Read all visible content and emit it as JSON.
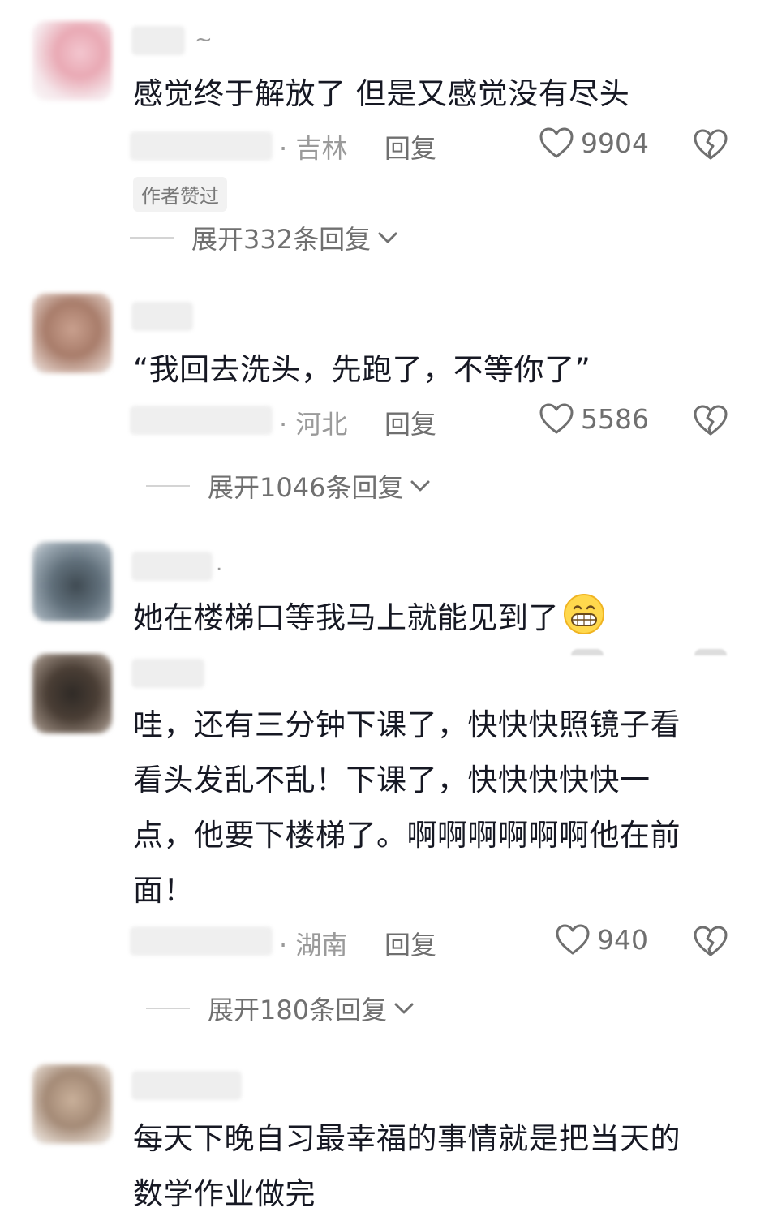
{
  "comments": [
    {
      "name_suffix": "~",
      "text": "感觉终于解放了 但是又感觉没有尽头",
      "location": "· 吉林",
      "reply_label": "回复",
      "likes": "9904",
      "badge": "作者赞过",
      "expand": "展开332条回复"
    },
    {
      "text": "“我回去洗头，先跑了，不等你了”",
      "location": "· 河北",
      "reply_label": "回复",
      "likes": "5586",
      "expand": "展开1046条回复"
    },
    {
      "name_suffix": ".",
      "text": "她在楼梯口等我马上就能见到了",
      "emoji": "grinning-face-icon"
    },
    {
      "text_lines": [
        "哇，还有三分钟下课了，快快快照镜子看",
        "看头发乱不乱！下课了，快快快快快一",
        "点，他要下楼梯了。啊啊啊啊啊啊他在前",
        "面！"
      ],
      "location": "· 湖南",
      "reply_label": "回复",
      "likes": "940",
      "expand": "展开180条回复"
    },
    {
      "text_lines": [
        "每天下晚自习最幸福的事情就是把当天的",
        "数学作业做完"
      ]
    }
  ],
  "icons": {
    "like": "heart-outline-icon",
    "dislike": "broken-heart-icon",
    "expand": "chevron-down-icon"
  },
  "colors": {
    "text": "#161823",
    "meta": "#9a9a9a",
    "secondary": "#6f6f6f"
  }
}
